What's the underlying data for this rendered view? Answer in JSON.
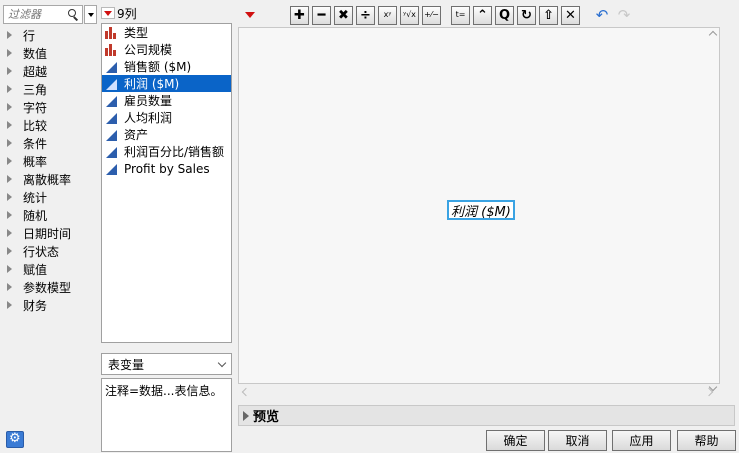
{
  "filter": {
    "placeholder": "过滤器"
  },
  "functions": [
    "行",
    "数值",
    "超越",
    "三角",
    "字符",
    "比较",
    "条件",
    "概率",
    "离散概率",
    "统计",
    "随机",
    "日期时间",
    "行状态",
    "赋值",
    "参数模型",
    "财务"
  ],
  "columns": {
    "count_label": "9列",
    "items": [
      {
        "label": "类型",
        "type": "nominal",
        "selected": false
      },
      {
        "label": "公司规模",
        "type": "nominal",
        "selected": false
      },
      {
        "label": "销售额 ($M)",
        "type": "continuous",
        "selected": false
      },
      {
        "label": "利润 ($M)",
        "type": "continuous",
        "selected": true
      },
      {
        "label": "雇员数量",
        "type": "continuous",
        "selected": false
      },
      {
        "label": "人均利润",
        "type": "continuous",
        "selected": false
      },
      {
        "label": "资产",
        "type": "continuous",
        "selected": false
      },
      {
        "label": "利润百分比/销售额",
        "type": "continuous",
        "selected": false
      },
      {
        "label": "Profit by Sales",
        "type": "continuous",
        "selected": false
      }
    ]
  },
  "table_variable": {
    "selected": "表变量"
  },
  "note": "注释=数据...表信息。",
  "toolbar": {
    "buttons": [
      {
        "name": "add-button",
        "glyph": "✚"
      },
      {
        "name": "subtract-button",
        "glyph": "━"
      },
      {
        "name": "multiply-button",
        "glyph": "✖"
      },
      {
        "name": "divide-button",
        "glyph": "÷"
      },
      {
        "name": "power-button",
        "glyph": "xʸ"
      },
      {
        "name": "root-button",
        "glyph": "ʸ√x"
      },
      {
        "name": "negate-button",
        "glyph": "+⁄−"
      },
      {
        "name": "local-variable-button",
        "glyph": "t="
      },
      {
        "name": "peel-button",
        "glyph": "⌃"
      },
      {
        "name": "unary-button",
        "glyph": "Q"
      },
      {
        "name": "swap-button",
        "glyph": "↻"
      },
      {
        "name": "insert-button",
        "glyph": "⇧"
      },
      {
        "name": "delete-button",
        "glyph": "✕"
      }
    ]
  },
  "formula": {
    "text": "利润 ($M)"
  },
  "preview": {
    "label": "预览"
  },
  "dialog_buttons": {
    "ok": "确定",
    "cancel": "取消",
    "apply": "应用",
    "help": "帮助"
  }
}
